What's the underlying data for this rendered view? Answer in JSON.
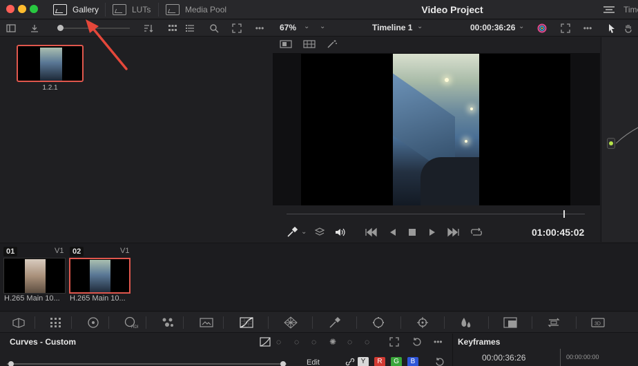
{
  "header": {
    "tabs": [
      {
        "label": "Gallery",
        "icon": "gallery-icon",
        "active": true
      },
      {
        "label": "LUTs",
        "icon": "luts-icon",
        "active": false
      },
      {
        "label": "Media Pool",
        "icon": "media-pool-icon",
        "active": false
      }
    ],
    "project_title": "Video Project",
    "right_tab_label": "Timeline"
  },
  "viewer_toolbar": {
    "zoom": "67%",
    "timeline_name": "Timeline 1",
    "timecode": "00:00:36:26"
  },
  "gallery": {
    "stills": [
      {
        "label": "1.2.1"
      }
    ]
  },
  "transport": {
    "timecode": "01:00:45:02"
  },
  "clips": [
    {
      "number": "01",
      "track": "V1",
      "label": "H.265 Main 10...",
      "selected": false
    },
    {
      "number": "02",
      "track": "V1",
      "label": "H.265 Main 10...",
      "selected": true
    }
  ],
  "curves": {
    "title": "Curves - Custom",
    "edit_label": "Edit",
    "channels": [
      {
        "label": "Y",
        "color": "#d8d8d8"
      },
      {
        "label": "R",
        "color": "#d23a32"
      },
      {
        "label": "G",
        "color": "#3aa63a"
      },
      {
        "label": "B",
        "color": "#2f56d8"
      }
    ]
  },
  "keyframes": {
    "title": "Keyframes",
    "timecode": "00:00:36:26",
    "ruler_timecode": "00:00:00:00"
  },
  "colors": {
    "selection": "#e0574d",
    "node_active": "#b6e34a"
  }
}
